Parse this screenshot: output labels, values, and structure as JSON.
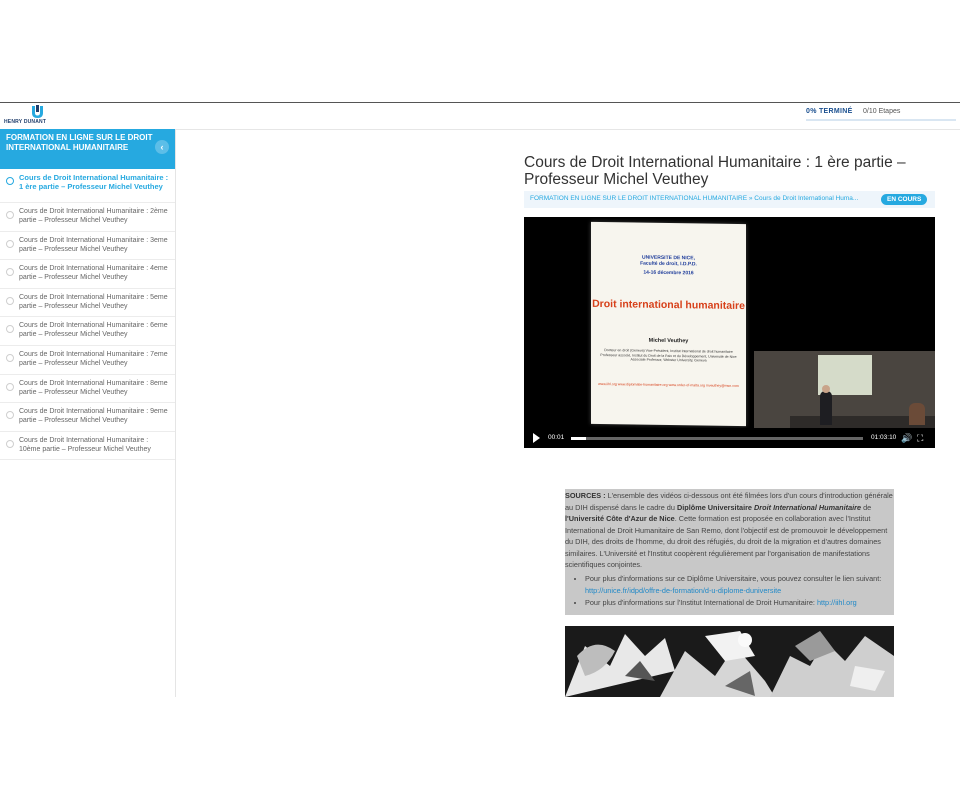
{
  "header": {
    "logo_text": "HENRY DUNANT",
    "progress_label": "0% TERMINÉ",
    "progress_percent": 0,
    "steps": "0/10 Etapes"
  },
  "sidebar": {
    "course_title": "FORMATION EN LIGNE SUR LE DROIT INTERNATIONAL HUMANITAIRE",
    "collapse_icon": "chevron-left-icon",
    "lessons": [
      {
        "label": "Cours de Droit International Humanitaire : 1 ère partie – Professeur Michel Veuthey"
      },
      {
        "label": "Cours de Droit International Humanitaire : 2ème partie – Professeur Michel Veuthey"
      },
      {
        "label": "Cours de Droit International Humanitaire : 3eme partie – Professeur Michel Veuthey"
      },
      {
        "label": "Cours de Droit International Humanitaire : 4eme partie – Professeur Michel Veuthey"
      },
      {
        "label": "Cours de Droit International Humanitaire : 5eme partie – Professeur Michel Veuthey"
      },
      {
        "label": "Cours de Droit International Humanitaire : 6eme partie – Professeur Michel Veuthey"
      },
      {
        "label": "Cours de Droit International Humanitaire : 7eme partie – Professeur Michel Veuthey"
      },
      {
        "label": "Cours de Droit International Humanitaire : 8eme partie – Professeur Michel Veuthey"
      },
      {
        "label": "Cours de Droit International Humanitaire : 9eme partie – Professeur Michel Veuthey"
      },
      {
        "label": "Cours de Droit International Humanitaire : 10ème partie – Professeur Michel Veuthey"
      }
    ]
  },
  "main": {
    "title": "Cours de Droit International Humanitaire : 1 ère partie – Professeur Michel Veuthey",
    "breadcrumb": "FORMATION EN LIGNE SUR LE DROIT INTERNATIONAL HUMANITAIRE » Cours de Droit International Huma...",
    "status_badge": "EN COURS"
  },
  "video": {
    "slide": {
      "university": "UNIVERSITE DE NICE,",
      "faculty": "Faculté de droit, I.D.P.D.",
      "dates": "14-16 décembre 2016",
      "title": "Droit international humanitaire",
      "author": "Michel Veuthey",
      "bio": "Docteur en droit (Geneva) Vice-Président, Institut International de droit humanitaire Professeur associé, Institut du Droit de la Paix et du Développement, Université de Nice Associate Professor, Webster University, Geneva",
      "links": "www.iihl.org www.diplomatie-humanitaire.org www.order-of-malta.org mveuthey@msn.com"
    },
    "current_time": "00:01",
    "duration": "01:03:10",
    "progress_fraction": 0.05,
    "play_icon": "play-icon",
    "volume_icon": "volume-icon",
    "fullscreen_icon": "fullscreen-icon"
  },
  "sources": {
    "label": "SOURCES :",
    "text_1": " L'ensemble des vidéos ci-dessous ont été filmées lors d'un cours d'introduction générale au DIH dispensé dans le cadre du ",
    "diploma": "Diplôme Universitaire",
    "diploma_name": "Droit International Humanitaire",
    "text_2": " de ",
    "university": "l'Université Côte d'Azur de Nice",
    "text_3": ". Cette formation est proposée en collaboration avec l'Institut International de Droit Humanitaire de San Remo, dont l'objectif est de promouvoir le développement du DIH, des droits de l'homme, du droit des réfugiés, du droit de la migration et d'autres domaines similaires. L'Université et l'Institut coopèrent régulièrement par l'organisation de manifestations scientifiques conjointes.",
    "item1_text": "Pour plus d'informations sur ce Diplôme Universitaire, vous pouvez consulter le lien suivant: ",
    "item1_link": "http://unice.fr/idpd/offre-de-formation/d-u-diplome-duniversite",
    "item2_text": "Pour plus d'informations sur l'Institut International de Droit Humanitaire: ",
    "item2_link": "http://iihl.org"
  },
  "colors": {
    "accent": "#26a9e0",
    "title_text": "#333333",
    "sources_bg": "#c8c8c8"
  }
}
